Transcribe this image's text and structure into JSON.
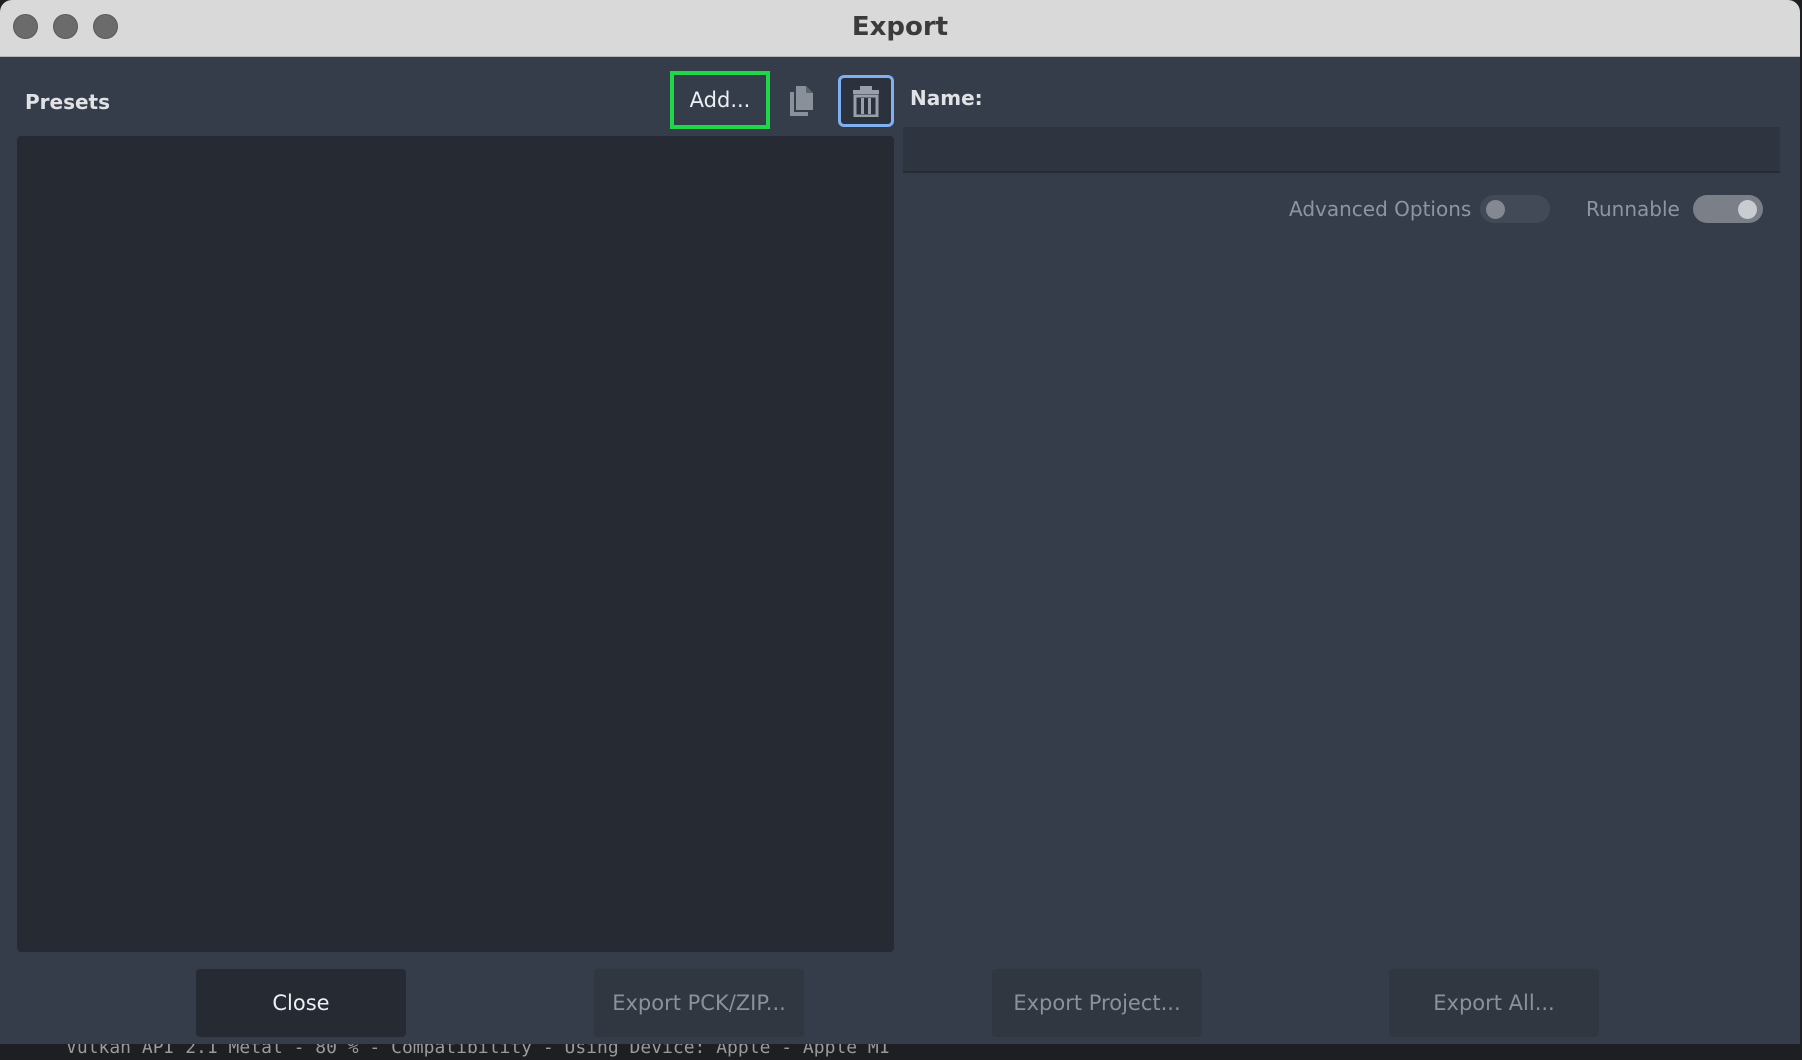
{
  "window": {
    "title": "Export"
  },
  "presets": {
    "label": "Presets",
    "add_label": "Add...",
    "items": []
  },
  "name": {
    "label": "Name:",
    "value": ""
  },
  "options": {
    "advanced_label": "Advanced Options",
    "advanced_on": false,
    "runnable_label": "Runnable",
    "runnable_on": true
  },
  "buttons": {
    "close": "Close",
    "export_pck": "Export PCK/ZIP...",
    "export_project": "Export Project...",
    "export_all": "Export All..."
  },
  "background_console": "Vulkan API 2.1 Metal - 80 % - Compatibility - Using Device: Apple - Apple M1",
  "colors": {
    "focus_highlight": "#1fd84a",
    "selected_outline": "#7fb0f0",
    "panel_bg": "#363d4a",
    "list_bg": "#262a33"
  }
}
